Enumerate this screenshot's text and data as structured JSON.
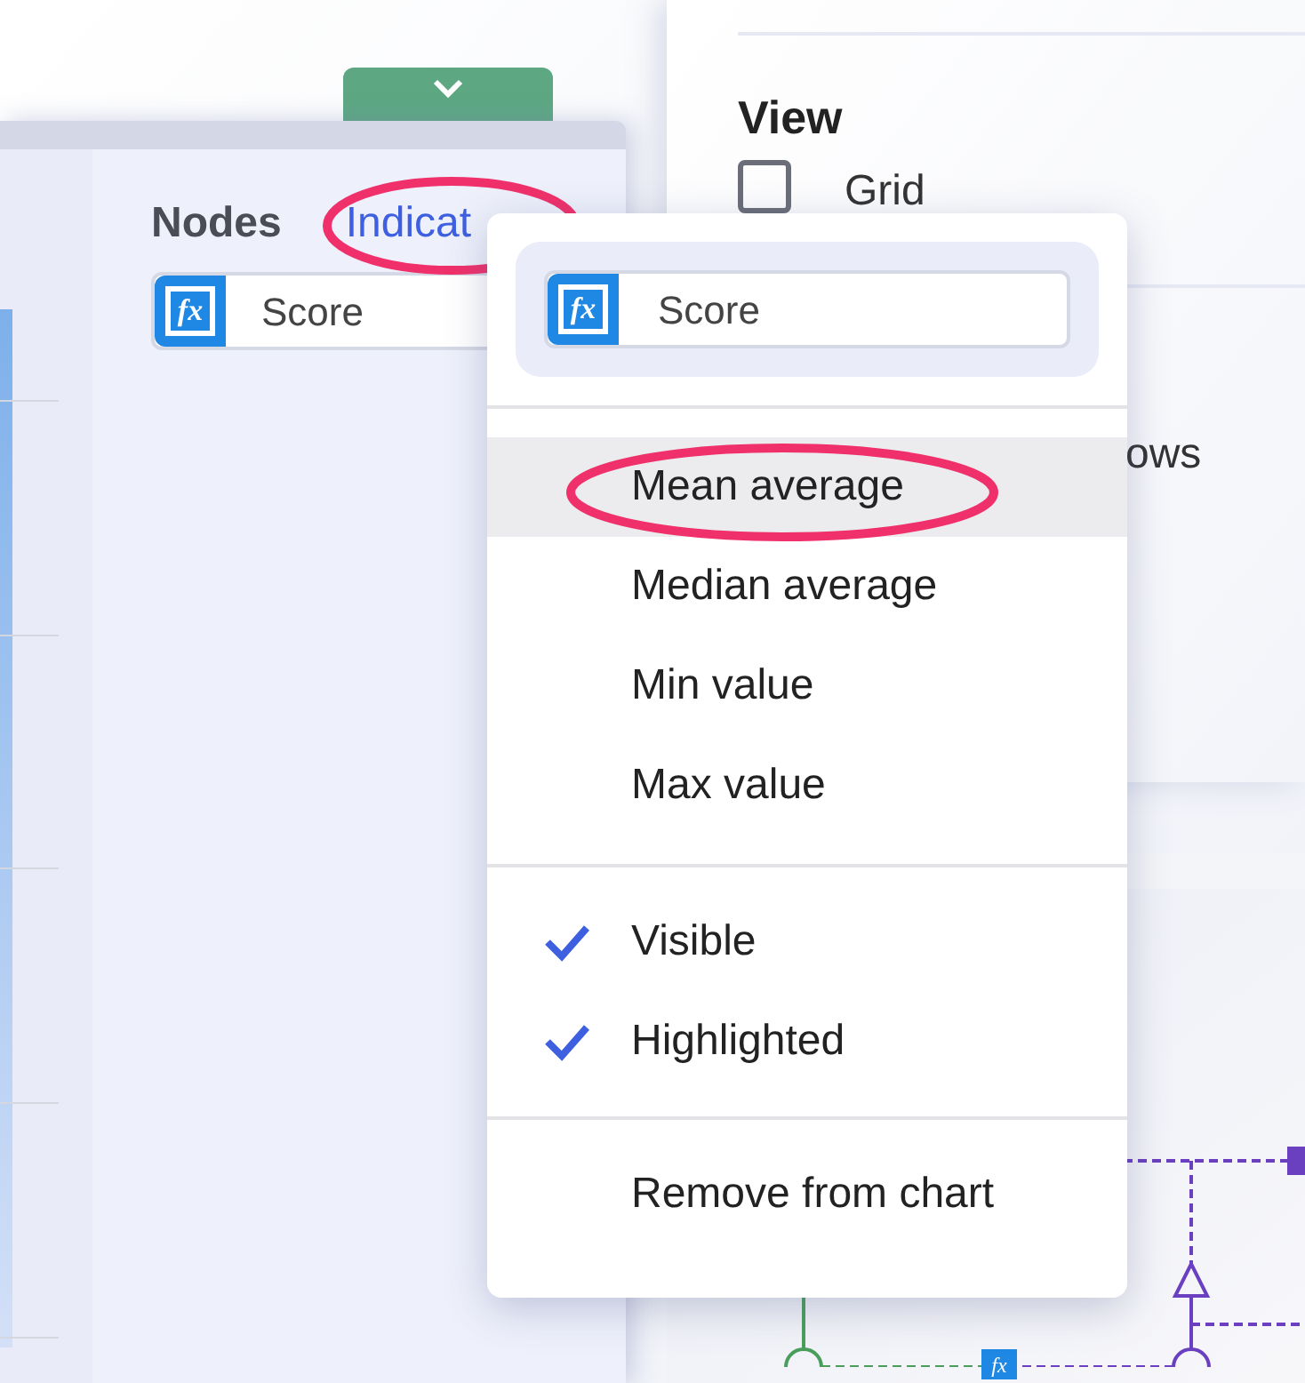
{
  "view_panel": {
    "title": "View",
    "grid": {
      "label": "Grid",
      "checked": false
    },
    "partial_label": "ows"
  },
  "nodes_panel": {
    "tabs": [
      {
        "label": "Nodes",
        "selected": false
      },
      {
        "label": "Indicat",
        "selected": true
      }
    ],
    "indicator": {
      "icon_label": "fx",
      "name": "Score"
    }
  },
  "menu": {
    "field": {
      "icon_label": "fx",
      "value": "Score"
    },
    "sections": [
      [
        {
          "kind": "option",
          "label": "Mean average",
          "selected": true
        },
        {
          "kind": "option",
          "label": "Median average",
          "selected": false
        },
        {
          "kind": "option",
          "label": "Min value",
          "selected": false
        },
        {
          "kind": "option",
          "label": "Max value",
          "selected": false
        }
      ],
      [
        {
          "kind": "toggle",
          "label": "Visible",
          "checked": true
        },
        {
          "kind": "toggle",
          "label": "Highlighted",
          "checked": true
        }
      ],
      [
        {
          "kind": "action",
          "label": "Remove from chart"
        }
      ]
    ]
  },
  "diagram": {
    "icon_label": "fx"
  }
}
